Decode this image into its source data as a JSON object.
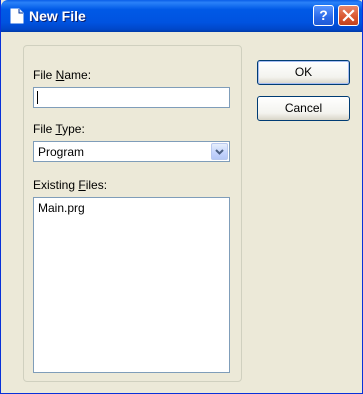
{
  "window": {
    "title": "New File",
    "help_label": "?",
    "colors": {
      "title_bar": "#0054e3",
      "dialog_bg": "#ece9d8",
      "field_border": "#7f9db9"
    }
  },
  "form": {
    "file_name": {
      "label_pre": "File ",
      "label_key": "N",
      "label_post": "ame:",
      "value": ""
    },
    "file_type": {
      "label_pre": "File ",
      "label_key": "T",
      "label_post": "ype:",
      "selected": "Program"
    },
    "existing_files": {
      "label_pre": "Existing ",
      "label_key": "F",
      "label_post": "iles:",
      "items": [
        "Main.prg"
      ]
    }
  },
  "buttons": {
    "ok": "OK",
    "cancel": "Cancel"
  },
  "icons": {
    "title": "document-icon",
    "help": "question-mark-icon",
    "close": "close-x-icon",
    "dropdown": "chevron-down-icon"
  }
}
